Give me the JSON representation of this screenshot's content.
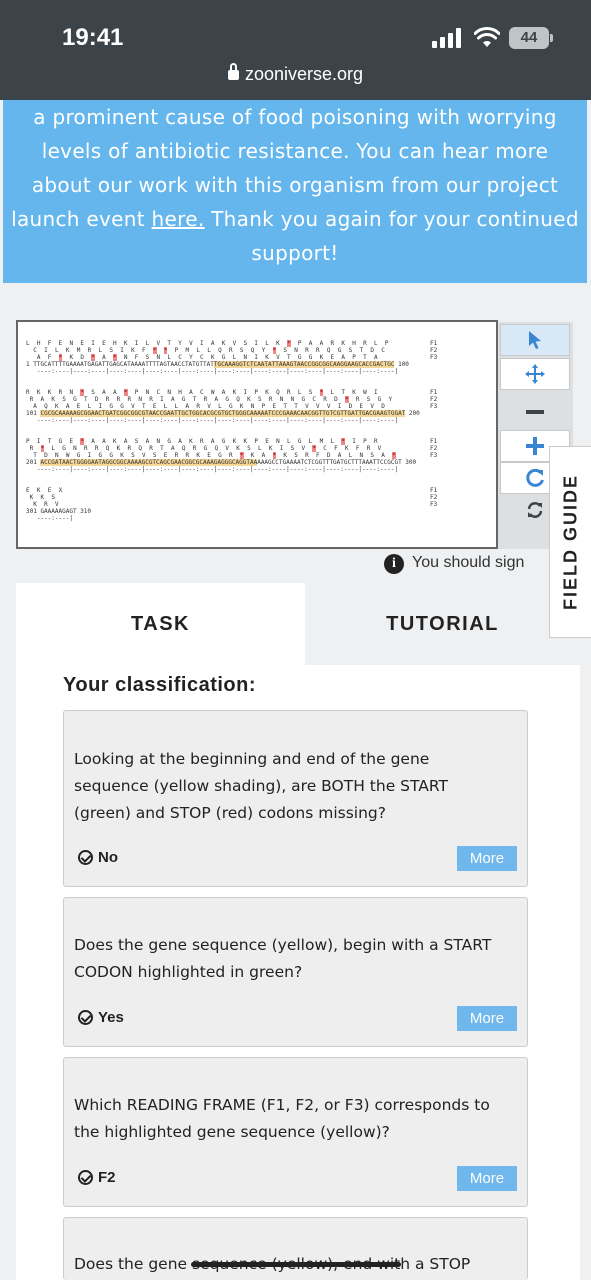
{
  "status_bar": {
    "time": "19:41",
    "battery": "44"
  },
  "browser": {
    "url": "zooniverse.org"
  },
  "banner": {
    "line1": "a prominent cause of food poisoning with worrying",
    "line2": "levels of antibiotic resistance. You can hear more",
    "line3": "about our work with this organism from our project",
    "line4_before": "launch event ",
    "line4_link": "here.",
    "line4_after": " Thank you again for your continued",
    "line5": "support!"
  },
  "sequence": {
    "block1": {
      "f1": "L  H  F  E  N  E  I  E  H  K  I  L  V  T  Y  V  I  A  K  V  S  I  L  K  *  P  A  A  R  K  H  R  L  P",
      "f2": "  C  I  L  K  M  R  L  S  I  K  F  *  *  P  M  L  L  Q  R  S  Q  Y  *  S  N  R  R  Q  G  S  T  D  C",
      "f3": "   A  F  *  K  D  *  A  *  N  F  S  N  L  C  Y  C  K  G  L  N  I  K  V  T  G  G  K  E  A  P  T  A",
      "dna_pre": "1 TTGCATTTTGAAAATGAGATTGAGCATAAAATTTTAGTAACCTATGTTAT",
      "dna_hl": "TGCAAAGGTCTCAATATTAAAGTAACCGGCGGCAAGGAAGCACCGACTGC",
      "dna_post": " 100",
      "ruler": "   ----:----|----:----|----:----|----:----|----:----|----:----|----:----|----:----|----:----|----:----|"
    },
    "block2": {
      "f1": "R  K  K  R  N  *  S  A  A  *  P  N  C  N  H  A  C  W  A  K  I  P  K  Q  R  L  S  *  L  T  K  W  I",
      "f2": " R  A  K  S  G  T  D  R  R  R  N  R  I  A  G  T  R  A  G  Q  K  S  R  N  N  G  C  R  D  *  R  S  G  Y",
      "f3": "  A  Q  K  A  E  L  I  G  G  V  T  E  L  L  A  R  V  L  G  K  N  P  E  T  T  V  V  V  I  D  E  V  D",
      "num": "101 ",
      "dna_hl": "CGCGCAAAAAGCGGAACTGATCGGCGGCGTAACCGAATTGCTGGCACGCGTGCTGGGCAAAAATCCCGAAACAACGGTTGTCGTTGATTGACGAAGTGGAT",
      "dna_post": " 200",
      "ruler": "   ----:----|----:----|----:----|----:----|----:----|----:----|----:----|----:----|----:----|----:----|"
    },
    "block3": {
      "f1": "P  I  T  G  E  *  A  A  K  A  S  A  N  G  A  K  R  A  G  K  K  P  E  N  L  G  L  M  L  *  I  P  R",
      "f2": " R  *  L  G  N  R  R  Q  K  R  Q  R  T  A  Q  R  G  Q  V  K  S  L  K  I  S  V  *  C  F  K  F  R  V",
      "f3": "  T  D  N  W  G  I  G  G  K  S  V  S  E  R  R  K  E  G  R  *  K  A  *  K  S  R  F  D  A  L  N  S  A  *",
      "num": "201 ",
      "dna_hl": "ACCGATAACTGGGGAATAGGCGGCAAAAGCGTCAGCGAACGGCGCAAAGAGGGCAGGTAA",
      "dna_post": "AAAGCCTGAAAATCTCGGTTTGATGCTTTAAATTCCGCGT 300",
      "ruler": "   ----:----|----:----|----:----|----:----|----:----|----:----|----:----|----:----|----:----|----:----|"
    },
    "block4": {
      "f1": "E  K  E  X",
      "f2": " K  K  S",
      "f3": "  K  R  V",
      "dna": "301 GAAAAAGAGT 310",
      "ruler": "   ----:----|"
    },
    "frame_labels": [
      "F1",
      "F2",
      "F3"
    ]
  },
  "toolbar": {
    "tools": [
      "pointer-icon",
      "move-icon",
      "zoom-out-icon",
      "zoom-in-icon",
      "reset-icon",
      "rotate-icon"
    ],
    "accent": "#3a84d4"
  },
  "signin_notice": "You should sign",
  "field_guide_label": "FIELD GUIDE",
  "tabs": {
    "task": "TASK",
    "tutorial": "TUTORIAL"
  },
  "classification": {
    "heading": "Your classification:",
    "questions": [
      {
        "q1": "Looking at the beginning and end of the gene",
        "q2": "sequence (yellow shading), are BOTH the START",
        "q3": "(green) and STOP (red) codons missing?",
        "answer": "No",
        "more": "More"
      },
      {
        "q1": "Does the gene sequence (yellow), begin with a START",
        "q2": "CODON highlighted in green?",
        "answer": "Yes",
        "more": "More"
      },
      {
        "q1": "Which READING FRAME (F1, F2, or F3) corresponds to",
        "q2": "the highlighted gene sequence (yellow)?",
        "answer": "F2",
        "more": "More"
      },
      {
        "q1": "Does the gene sequence (yellow), end with a STOP"
      }
    ]
  }
}
